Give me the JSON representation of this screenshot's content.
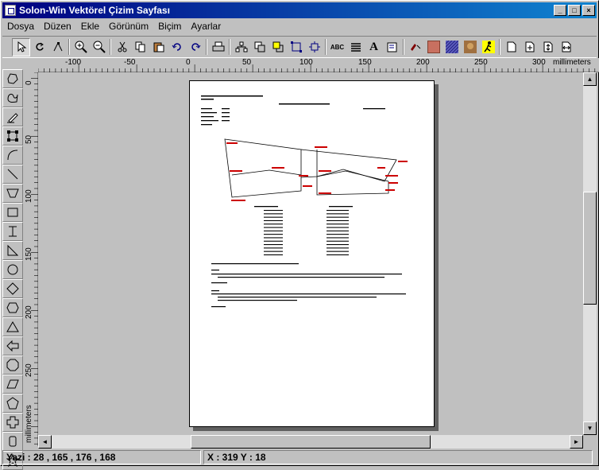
{
  "window": {
    "title": "Solon-Win Vektörel Çizim Sayfası"
  },
  "title_buttons": {
    "minimize": "_",
    "maximize": "□",
    "close": "×"
  },
  "menu": [
    "Dosya",
    "Düzen",
    "Ekle",
    "Görünüm",
    "Biçim",
    "Ayarlar"
  ],
  "ruler": {
    "top_labels": [
      "-100",
      "-50",
      "0",
      "50",
      "100",
      "150",
      "200",
      "250",
      "300"
    ],
    "top_unit": "millimeters",
    "left_labels": [
      "0",
      "50",
      "100",
      "150",
      "200",
      "250"
    ],
    "left_unit": "millimeters"
  },
  "toolbar": {
    "text_tool": "ABC",
    "font_tool": "A"
  },
  "status": {
    "left": "Yazi : 28 , 165 , 176 , 168",
    "right": "X : 319 Y : 18"
  },
  "colors": {
    "title_start": "#000080",
    "title_end": "#1084d0",
    "drawing_red": "#cc0000"
  }
}
